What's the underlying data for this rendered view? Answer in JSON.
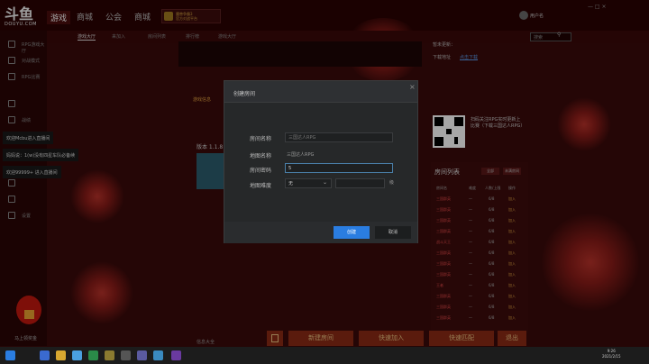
{
  "app": {
    "logo": "斗鱼",
    "logo_sub": "DOUYU.COM",
    "accent": "#2a7de1",
    "bg": "#3a0a0a"
  },
  "topnav": [
    "游戏",
    "商城",
    "公会",
    "商城"
  ],
  "game_badge": [
    "魔兽争霸3",
    "官方对战平台"
  ],
  "user": {
    "name": "用户名"
  },
  "window_controls": "— □ ×",
  "sidebar": [
    {
      "label": "RPG游戏大厅",
      "icon": "gamepad-icon"
    },
    {
      "label": "对战模式",
      "icon": "versus-icon"
    },
    {
      "label": "RPG比赛",
      "icon": "trophy-icon"
    },
    {
      "label": "",
      "icon": "chat-icon"
    },
    {
      "label": "战绩",
      "icon": "stats-icon"
    },
    {
      "label": "",
      "icon": "shop-icon"
    },
    {
      "label": "",
      "icon": "friends-icon"
    },
    {
      "label": "",
      "icon": "settings-icon"
    },
    {
      "label": "设置",
      "icon": "grid-icon"
    }
  ],
  "chat_messages": [
    "欢迎Mcbu进入直播间",
    "妈妈说：1(w)没有四星车队必备续",
    "欢迎99999+ 进入直播间"
  ],
  "hongbao_label": "马上领奖金",
  "subtabs": [
    "游戏大厅",
    "来加入",
    "房间列表",
    "排行榜",
    "游戏大厅"
  ],
  "search": {
    "placeholder": "搜索"
  },
  "info": {
    "line1": "暂未更新：",
    "line2": "下载地址",
    "link": "点击下载"
  },
  "main_tab": "游戏信息",
  "version": "版本 1.1.8",
  "notices": [],
  "qr": {
    "text": "扫码关注RPG实时更新上比赛（下载三国达人RPG）"
  },
  "roomlist": {
    "title": "房间列表",
    "filter_btns": [
      "全部",
      "未满房间"
    ],
    "columns": [
      "房间名",
      "难度",
      "人数/上限",
      "操作"
    ],
    "rows": [
      {
        "name": "三国群英",
        "diff": "—",
        "count": "6/8",
        "action": "加入"
      },
      {
        "name": "三国群英",
        "diff": "—",
        "count": "6/8",
        "action": "加入"
      },
      {
        "name": "三国群英",
        "diff": "—",
        "count": "6/8",
        "action": "加入"
      },
      {
        "name": "三国群英",
        "diff": "—",
        "count": "6/8",
        "action": "加入"
      },
      {
        "name": "战斗天王",
        "diff": "—",
        "count": "6/8",
        "action": "加入"
      },
      {
        "name": "三国群英",
        "diff": "—",
        "count": "6/8",
        "action": "加入"
      },
      {
        "name": "三国群英",
        "diff": "—",
        "count": "6/8",
        "action": "加入"
      },
      {
        "name": "三国群英",
        "diff": "—",
        "count": "6/8",
        "action": "加入"
      },
      {
        "name": "王者",
        "diff": "—",
        "count": "6/8",
        "action": "加入"
      },
      {
        "name": "三国群英",
        "diff": "—",
        "count": "6/8",
        "action": "加入"
      },
      {
        "name": "三国群英",
        "diff": "—",
        "count": "6/8",
        "action": "加入"
      },
      {
        "name": "三国群英",
        "diff": "—",
        "count": "6/8",
        "action": "加入"
      }
    ]
  },
  "bottom_buttons": [
    "新建房间",
    "快速加入",
    "快速匹配",
    "退出"
  ],
  "footer_tab": "信息大全",
  "modal": {
    "title": "创建房间",
    "room_name_label": "房间名称",
    "room_name_placeholder": "三国达人RPG",
    "map_name_label": "地图名称",
    "map_name_value": "三国达人RPG",
    "room_pwd_label": "房间密码",
    "room_pwd_value": "5",
    "map_diff_label": "地图难度",
    "map_diff_value": "无",
    "level_unit": "级",
    "create_btn": "创建",
    "cancel_btn": "取消",
    "close": "×"
  },
  "taskbar": {
    "time": "9:26",
    "date": "2021/2/15"
  }
}
